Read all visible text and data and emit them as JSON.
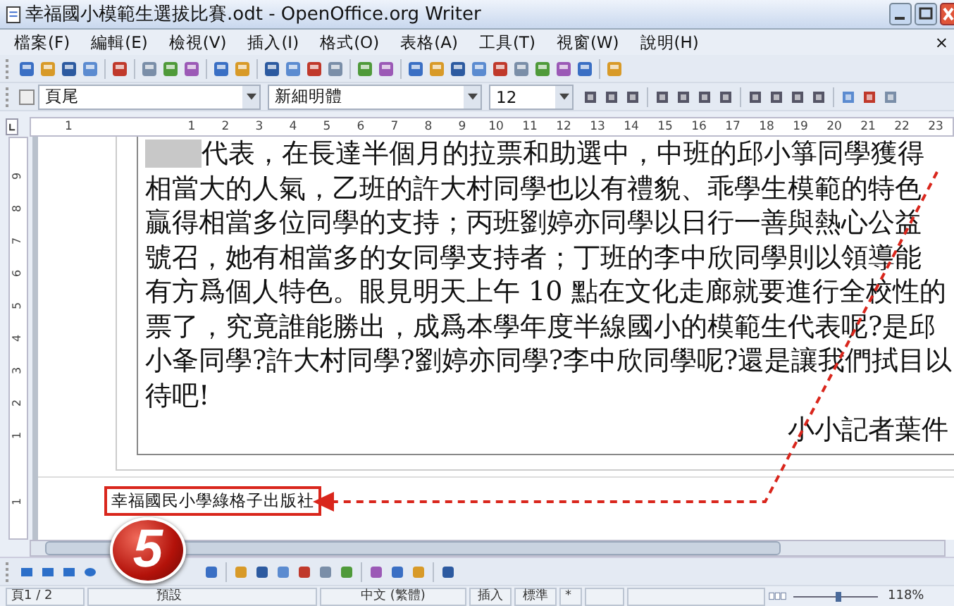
{
  "window": {
    "title": "幸福國小模範生選拔比賽.odt - OpenOffice.org Writer"
  },
  "menu": {
    "items": [
      "檔案(F)",
      "編輯(E)",
      "檢視(V)",
      "插入(I)",
      "格式(O)",
      "表格(A)",
      "工具(T)",
      "視窗(W)",
      "說明(H)"
    ],
    "close": "×"
  },
  "format_toolbar": {
    "style": "頁尾",
    "font": "新細明體",
    "size": "12"
  },
  "ruler": {
    "ticks": [
      "1",
      "1",
      "2",
      "3",
      "4",
      "5",
      "6",
      "7",
      "8",
      "9",
      "10",
      "11",
      "12",
      "13",
      "14",
      "15",
      "16",
      "17",
      "18",
      "19",
      "20",
      "21",
      "22",
      "23"
    ]
  },
  "vertical_ruler": {
    "ticks": [
      "9",
      "8",
      "7",
      "6",
      "5",
      "4",
      "3",
      "2",
      "1",
      "1"
    ]
  },
  "document": {
    "lines": [
      "代表，在長達半個月的拉票和助選中，中班的邱小箏同學獲得",
      "相當大的人氣，乙班的許大村同學也以有禮貌、乖學生模範的特色",
      "贏得相當多位同學的支持；丙班劉婷亦同學以日行一善與熱心公益",
      "號召，她有相當多的女同學支持者；丁班的李中欣同學則以領導能",
      "有方爲個人特色。眼見明天上午 10 點在文化走廊就要進行全校性的",
      "票了，究竟誰能勝出，成爲本學年度半線國小的模範生代表呢?是邱",
      "小夆同學?許大村同學?劉婷亦同學?李中欣同學呢?還是讓我們拭目以",
      "待吧!"
    ],
    "signature": "小小記者葉件",
    "footer": "幸福國民小學綠格子出版社"
  },
  "badge": "5",
  "status_bar": {
    "page": "頁1 / 2",
    "style": "預設",
    "language": "中文 (繁體)",
    "mode": "插入",
    "selection": "標準",
    "modified": "*",
    "zoom": "118%",
    "zoom_slider": {
      "level": 0.55
    }
  }
}
